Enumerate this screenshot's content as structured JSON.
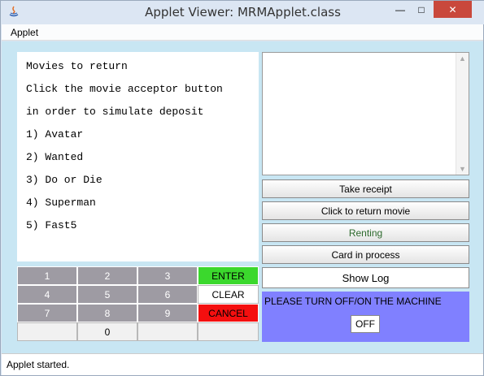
{
  "window": {
    "title": "Applet Viewer: MRMApplet.class",
    "minimize": "—",
    "maximize": "□",
    "close": "✕"
  },
  "menu": {
    "applet": "Applet"
  },
  "instructions": {
    "lines": [
      "Movies to return",
      "Click the movie acceptor button",
      "in order to simulate deposit",
      "1) Avatar",
      "2) Wanted",
      "3) Do or Die",
      "4) Superman",
      "5) Fast5"
    ]
  },
  "side_buttons": {
    "take_receipt": "Take receipt",
    "return_movie": "Click to return movie",
    "renting": "Renting",
    "card_in_process": "Card in process",
    "show_log": "Show Log"
  },
  "power": {
    "message": "PLEASE TURN OFF/ON THE MACHINE",
    "off": "OFF"
  },
  "keypad": {
    "k1": "1",
    "k2": "2",
    "k3": "3",
    "enter": "ENTER",
    "k4": "4",
    "k5": "5",
    "k6": "6",
    "clear": "CLEAR",
    "k7": "7",
    "k8": "8",
    "k9": "9",
    "cancel": "CANCEL",
    "blank_left": "",
    "k0": "0",
    "blank_mid": "",
    "blank_right": ""
  },
  "status": {
    "text": "Applet started."
  },
  "colors": {
    "enter": "#3bd82d",
    "cancel": "#f40f0f",
    "power_panel": "#8080ff",
    "applet_bg": "#c8e6f3"
  }
}
